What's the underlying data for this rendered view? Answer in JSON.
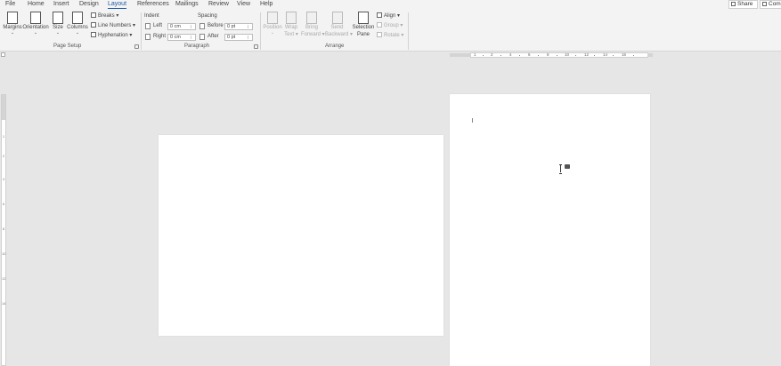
{
  "menu": {
    "tabs": [
      "File",
      "Home",
      "Insert",
      "Design",
      "Layout",
      "References",
      "Mailings",
      "Review",
      "View",
      "Help"
    ],
    "active_tab": "Layout",
    "share_label": "Share",
    "comments_label": "Com"
  },
  "ribbon": {
    "page_setup": {
      "margins": "Margins",
      "orientation": "Orientation",
      "size": "Size",
      "columns": "Columns",
      "breaks": "Breaks ▾",
      "line_numbers": "Line Numbers ▾",
      "hyphenation": "Hyphenation ▾",
      "group_label": "Page Setup"
    },
    "paragraph": {
      "indent_header": "Indent",
      "spacing_header": "Spacing",
      "left_label": "Left",
      "left_value": "0 cm",
      "right_label": "Right",
      "right_value": "0 cm",
      "before_label": "Before",
      "before_value": "0 pt",
      "after_label": "After",
      "after_value": "0 pt",
      "group_label": "Paragraph"
    },
    "arrange": {
      "position_l1": "Position",
      "position_l2": "",
      "wrap_l1": "Wrap",
      "wrap_l2": "Text ▾",
      "bring_l1": "Bring",
      "bring_l2": "Forward ▾",
      "send_l1": "Send",
      "send_l2": "Backward ▾",
      "selection_l1": "Selection",
      "selection_l2": "Pane",
      "align": "Align ▾",
      "group": "Group ▾",
      "rotate": "Rotate ▾",
      "group_label": "Arrange"
    }
  },
  "ruler": {
    "marks": [
      "1",
      "2",
      "4",
      "6",
      "8",
      "10",
      "12",
      "14",
      "16"
    ],
    "vmarks": [
      "1",
      "2",
      "4",
      "6",
      "8",
      "10",
      "12",
      "14"
    ]
  },
  "icons": {
    "share": "share-icon",
    "comments": "comment-icon",
    "cursor": "i-beam-cursor-icon",
    "anchor": "anchor-icon"
  }
}
